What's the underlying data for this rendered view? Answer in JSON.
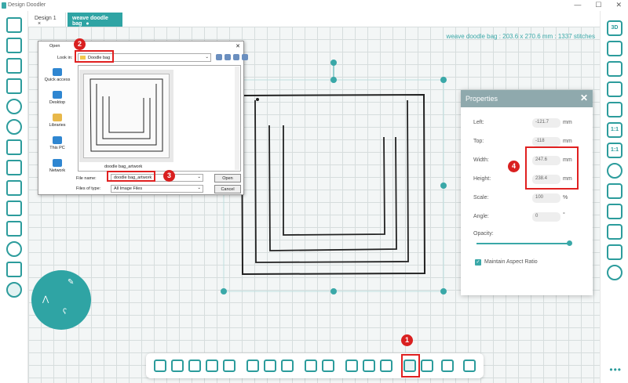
{
  "app": {
    "title": "Design Doodler"
  },
  "window": {
    "minimize": "—",
    "maximize": "☐",
    "close": "✕"
  },
  "tabs": [
    {
      "label": "Design 1",
      "close": "×"
    },
    {
      "label": "weave doodle bag",
      "dot": "●"
    }
  ],
  "design_info": "weave doodle bag : 203.6 x 270.6 mm : 1337 stitches",
  "open_dialog": {
    "title": "Open",
    "close": "✕",
    "look_in_label": "Look in:",
    "look_in_value": "Doodle bag",
    "places": [
      "Quick access",
      "Desktop",
      "Libraries",
      "This PC",
      "Network"
    ],
    "thumbnail_label": "doodle bag_artwork",
    "file_name_label": "File name:",
    "file_name_value": "doodle bag_artwork",
    "files_of_type_label": "Files of type:",
    "files_of_type_value": "All Image Files",
    "open_button": "Open",
    "cancel_button": "Cancel"
  },
  "properties": {
    "title": "Properties",
    "close": "✕",
    "left_label": "Left:",
    "left_value": "-121.7",
    "left_unit": "mm",
    "top_label": "Top:",
    "top_value": "-118",
    "top_unit": "mm",
    "width_label": "Width:",
    "width_value": "247.6",
    "width_unit": "mm",
    "height_label": "Height:",
    "height_value": "238.4",
    "height_unit": "mm",
    "scale_label": "Scale:",
    "scale_value": "100",
    "scale_unit": "%",
    "angle_label": "Angle:",
    "angle_value": "0",
    "angle_unit": "°",
    "opacity_label": "Opacity:",
    "opacity_level": 1.0,
    "aspect_label": "Maintain Aspect Ratio",
    "aspect_checked": true
  },
  "right_tools": [
    "3D",
    "1:1",
    "1:1"
  ],
  "callouts": [
    "1",
    "2",
    "3",
    "4"
  ],
  "more": "•••",
  "colors": {
    "accent": "#2fa4a4",
    "callout": "#e02020"
  }
}
